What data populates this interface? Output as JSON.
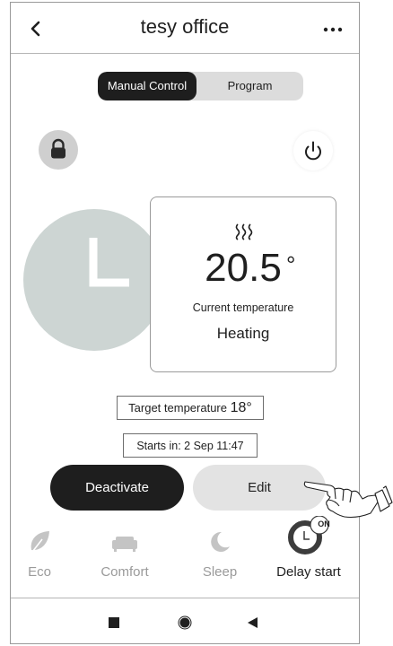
{
  "header": {
    "title": "tesy office",
    "back_icon": "chevron-left-icon",
    "more_icon": "more-horizontal-icon"
  },
  "mode_toggle": {
    "manual_label": "Manual Control",
    "program_label": "Program",
    "selected": "Manual Control"
  },
  "controls": {
    "lock_icon": "lock-icon",
    "power_icon": "power-icon"
  },
  "status": {
    "heat_icon": "heat-waves-icon",
    "current_temperature": "20.5",
    "degree_symbol": "°",
    "caption": "Current temperature",
    "state": "Heating"
  },
  "schedule": {
    "target_label": "Target temperature",
    "target_value": "18°",
    "starts_in": "Starts in: 2 Sep 11:47"
  },
  "actions": {
    "deactivate_label": "Deactivate",
    "edit_label": "Edit"
  },
  "modes": {
    "eco_label": "Eco",
    "comfort_label": "Comfort",
    "sleep_label": "Sleep",
    "delay_label": "Delay start",
    "delay_badge": "ON",
    "active": "Delay start"
  },
  "colors": {
    "dark": "#1e1e1e",
    "clock_circle": "#cdd5d3",
    "inactive_icon": "#c4c4c4",
    "inactive_text": "#9a9a9a",
    "segment_bg": "#dcdcdc",
    "edit_bg": "#e3e3e3"
  }
}
